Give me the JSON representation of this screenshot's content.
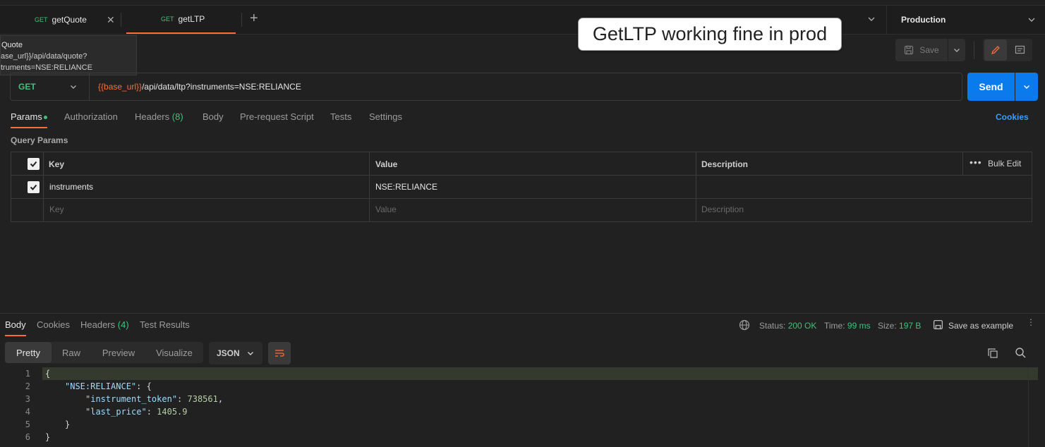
{
  "tabs": [
    {
      "method": "GET",
      "name": "getQuote"
    },
    {
      "method": "GET",
      "name": "getLTP"
    }
  ],
  "environment": "Production",
  "tooltip": {
    "line1": "Quote",
    "line2": "ase_url}}/api/data/quote?",
    "line3": "truments=NSE:RELIANCE"
  },
  "annotation": "GetLTP working fine in prod",
  "toolbar": {
    "save_label": "Save"
  },
  "request": {
    "method": "GET",
    "url_var": "{{base_url}}",
    "url_path": "/api/data/ltp?instruments=NSE:RELIANCE",
    "send_label": "Send"
  },
  "request_tabs": {
    "params": "Params",
    "authorization": "Authorization",
    "headers": "Headers",
    "headers_count": "(8)",
    "body": "Body",
    "prerequest": "Pre-request Script",
    "tests": "Tests",
    "settings": "Settings",
    "cookies": "Cookies"
  },
  "query_params": {
    "title": "Query Params",
    "columns": {
      "key": "Key",
      "value": "Value",
      "description": "Description"
    },
    "bulk_edit": "Bulk Edit",
    "rows": [
      {
        "checked": true,
        "key": "instruments",
        "value": "NSE:RELIANCE",
        "description": ""
      }
    ],
    "placeholders": {
      "key": "Key",
      "value": "Value",
      "description": "Description"
    }
  },
  "response": {
    "tabs": {
      "body": "Body",
      "cookies": "Cookies",
      "headers": "Headers",
      "headers_count": "(4)",
      "test_results": "Test Results"
    },
    "status_label": "Status:",
    "status_value": "200 OK",
    "time_label": "Time:",
    "time_value": "99 ms",
    "size_label": "Size:",
    "size_value": "197 B",
    "save_example": "Save as example",
    "modes": [
      "Pretty",
      "Raw",
      "Preview",
      "Visualize"
    ],
    "format": "JSON",
    "code_lines": [
      {
        "n": "1",
        "text": "{"
      },
      {
        "n": "2",
        "key": "\"NSE:RELIANCE\"",
        "rest": ": {"
      },
      {
        "n": "3",
        "key": "\"instrument_token\"",
        "num": "738561",
        "tail": ","
      },
      {
        "n": "4",
        "key": "\"last_price\"",
        "num": "1405.9",
        "tail": ""
      },
      {
        "n": "5",
        "text": "}"
      },
      {
        "n": "6",
        "text": "}"
      }
    ]
  },
  "colors": {
    "accent": "#ff6c37",
    "send": "#097bed",
    "method_get": "#3fc27a",
    "link": "#3a9dff"
  }
}
